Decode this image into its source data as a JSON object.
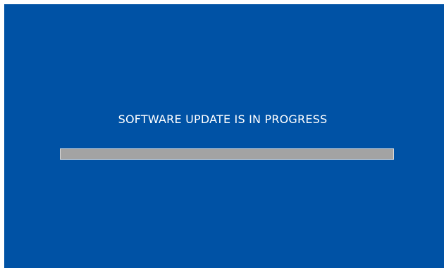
{
  "screen": {
    "background_color": "#0052a5",
    "message": "SOFTWARE UPDATE IS IN PROGRESS",
    "message_color": "#ffffff"
  },
  "progress": {
    "fraction": 1.0,
    "fill_color": "#a3a3a3",
    "border_color": "#dcdcdc"
  }
}
